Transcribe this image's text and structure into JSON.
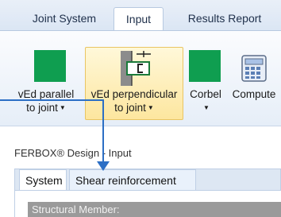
{
  "ribbon_tabs": [
    "Joint System",
    "Input",
    "Results Report"
  ],
  "ribbon_buttons": {
    "parallel": {
      "line1": "vEd parallel",
      "line2": "to joint"
    },
    "perpendicular": {
      "line1": "vEd perpendicular",
      "line2": "to joint"
    },
    "corbel": {
      "line1": "Corbel"
    },
    "compute": {
      "line1": "Compute"
    }
  },
  "panel": {
    "title": "FERBOX® Design - Input",
    "tabs": [
      "System",
      "Shear reinforcement"
    ],
    "section_header": "Structural Member:"
  },
  "colors": {
    "accent_green": "#0f9e50",
    "pointer": "#2c6fc5",
    "highlight": "#fde69f"
  }
}
